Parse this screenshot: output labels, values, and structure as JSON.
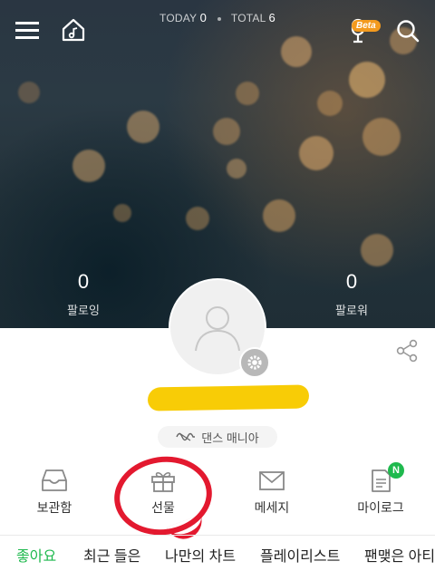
{
  "header": {
    "today_label": "TODAY",
    "today_count": "0",
    "total_label": "TOTAL",
    "total_count": "6",
    "beta_badge": "Beta",
    "icons": [
      "menu-icon",
      "home-music-icon",
      "mic-icon",
      "search-icon"
    ]
  },
  "profile": {
    "following_count": "0",
    "following_label": "팔로잉",
    "followers_count": "0",
    "followers_label": "팔로워",
    "badge_label": "댄스 매니아"
  },
  "menu": [
    {
      "label": "보관함",
      "icon": "inbox-icon"
    },
    {
      "label": "선물",
      "icon": "gift-icon"
    },
    {
      "label": "메세지",
      "icon": "envelope-icon"
    },
    {
      "label": "마이로그",
      "icon": "log-icon",
      "new_badge": "N"
    }
  ],
  "tabs": [
    "좋아요",
    "최근 들은",
    "나만의 차트",
    "플레이리스트",
    "팬맺은 아티"
  ],
  "colors": {
    "accent_green": "#1fb94e",
    "annotation_red": "#e3192f",
    "redaction_yellow": "#f8cc06"
  }
}
